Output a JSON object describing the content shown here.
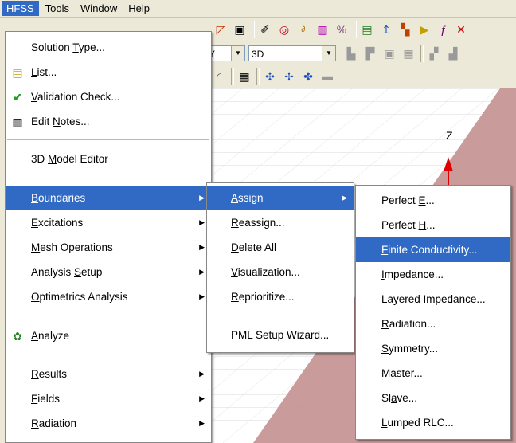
{
  "menubar": {
    "items": [
      "HFSS",
      "Tools",
      "Window",
      "Help"
    ]
  },
  "toolbar": {
    "combo1": "Y",
    "combo2": "3D"
  },
  "viewport": {
    "axis_label": "Z"
  },
  "hfss_menu": {
    "items": [
      {
        "pre": "Solution ",
        "acc": "T",
        "post": "ype...",
        "icon": ""
      },
      {
        "pre": "",
        "acc": "L",
        "post": "ist...",
        "icon": "list-icon"
      },
      {
        "pre": "",
        "acc": "V",
        "post": "alidation Check...",
        "icon": "validation-check-icon"
      },
      {
        "pre": "Edit ",
        "acc": "N",
        "post": "otes...",
        "icon": "notes-icon"
      },
      {
        "pre": "3D ",
        "acc": "M",
        "post": "odel Editor",
        "icon": ""
      },
      {
        "pre": "",
        "acc": "B",
        "post": "oundaries",
        "icon": "",
        "submenu": true
      },
      {
        "pre": "",
        "acc": "E",
        "post": "xcitations",
        "icon": "",
        "submenu": true
      },
      {
        "pre": "",
        "acc": "M",
        "post": "esh Operations",
        "icon": "",
        "submenu": true
      },
      {
        "pre": "Analysis ",
        "acc": "S",
        "post": "etup",
        "icon": "",
        "submenu": true
      },
      {
        "pre": "",
        "acc": "O",
        "post": "ptimetrics Analysis",
        "icon": "",
        "submenu": true
      },
      {
        "pre": "",
        "acc": "A",
        "post": "nalyze",
        "icon": "analyze-icon"
      },
      {
        "pre": "",
        "acc": "R",
        "post": "esults",
        "icon": "",
        "submenu": true
      },
      {
        "pre": "",
        "acc": "F",
        "post": "ields",
        "icon": "",
        "submenu": true
      },
      {
        "pre": "",
        "acc": "R",
        "post": "adiation",
        "icon": "",
        "submenu": true
      }
    ]
  },
  "boundaries_menu": {
    "items": [
      {
        "pre": "",
        "acc": "A",
        "post": "ssign",
        "submenu": true
      },
      {
        "pre": "",
        "acc": "R",
        "post": "eassign...",
        "submenu": false
      },
      {
        "pre": "",
        "acc": "D",
        "post": "elete All",
        "submenu": false
      },
      {
        "pre": "",
        "acc": "V",
        "post": "isualization...",
        "submenu": false
      },
      {
        "pre": "",
        "acc": "R",
        "post": "eprioritize...",
        "submenu": false
      },
      {
        "pre": "PML Setup Wizard...",
        "acc": "",
        "post": "",
        "submenu": false
      }
    ]
  },
  "assign_menu": {
    "items": [
      {
        "pre": "Perfect ",
        "acc": "E",
        "post": "..."
      },
      {
        "pre": "Perfect ",
        "acc": "H",
        "post": "..."
      },
      {
        "pre": "",
        "acc": "F",
        "post": "inite Conductivity..."
      },
      {
        "pre": "",
        "acc": "I",
        "post": "mpedance..."
      },
      {
        "pre": "Layered Impedance...",
        "acc": "",
        "post": ""
      },
      {
        "pre": "",
        "acc": "R",
        "post": "adiation..."
      },
      {
        "pre": "",
        "acc": "S",
        "post": "ymmetry..."
      },
      {
        "pre": "",
        "acc": "M",
        "post": "aster..."
      },
      {
        "pre": "Sl",
        "acc": "a",
        "post": "ve..."
      },
      {
        "pre": "",
        "acc": "L",
        "post": "umped RLC..."
      }
    ]
  },
  "colors": {
    "highlight": "#316ac5",
    "axis": "#e00000",
    "ground": "#c39090"
  }
}
